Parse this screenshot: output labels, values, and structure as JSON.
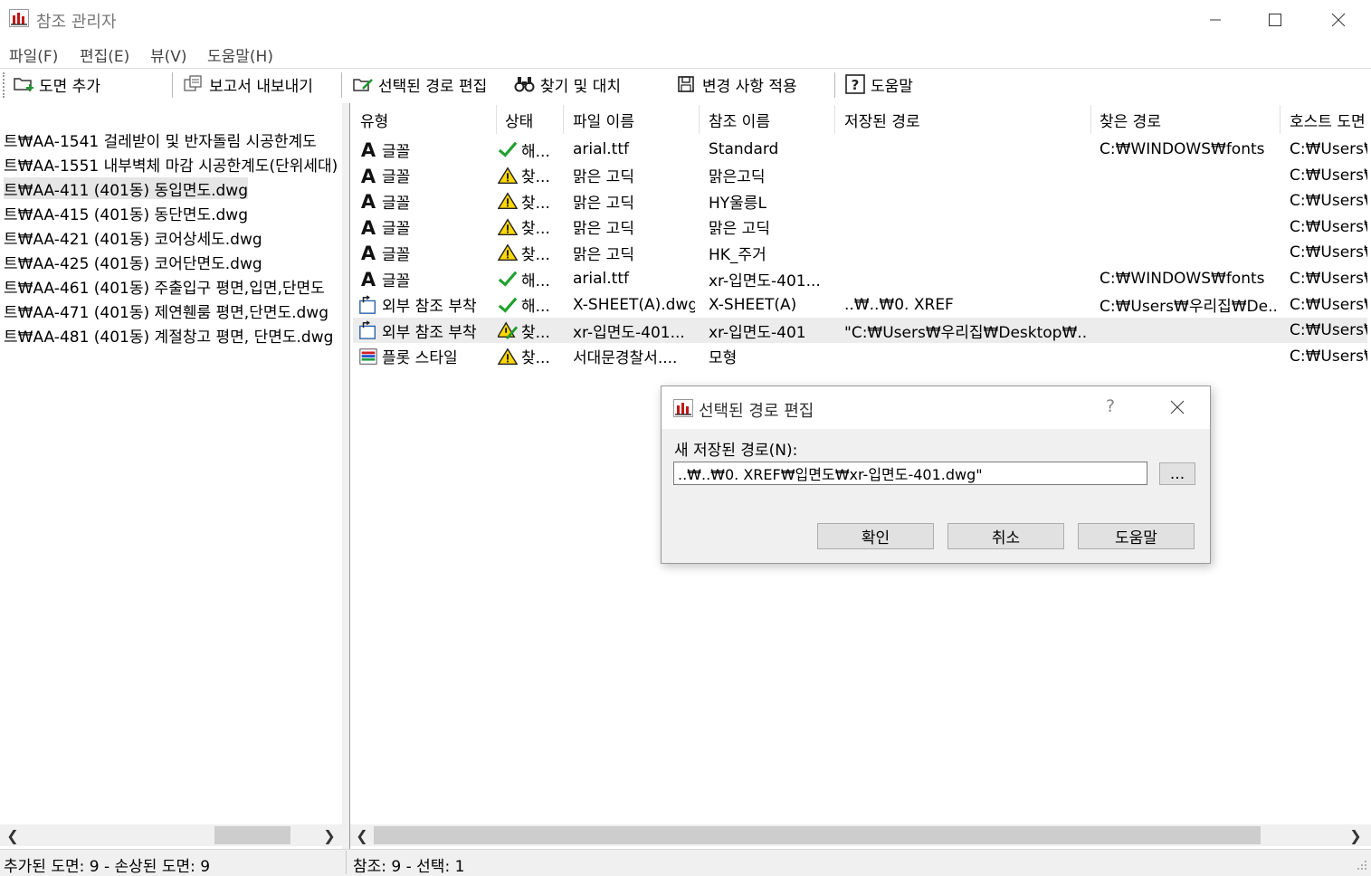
{
  "window": {
    "title": "참조 관리자"
  },
  "menu": [
    "파일(F)",
    "편집(E)",
    "뷰(V)",
    "도움말(H)"
  ],
  "toolbar": {
    "add_drawing": "도면 추가",
    "export_report": "보고서 내보내기",
    "edit_selected_path": "선택된 경로 편집",
    "find_replace": "찾기 및 대치",
    "apply_changes": "변경 사항 적용",
    "help": "도움말"
  },
  "left_pane": {
    "items": [
      "트₩AA-1541 걸레받이 및 반자돌림 시공한계도",
      "트₩AA-1551 내부벽체 마감 시공한계도(단위세대)",
      "트₩AA-411 (401동) 동입면도.dwg",
      "트₩AA-415 (401동) 동단면도.dwg",
      "트₩AA-421 (401동) 코어상세도.dwg",
      "트₩AA-425 (401동) 코어단면도.dwg",
      "트₩AA-461 (401동) 주출입구 평면,입면,단면도",
      "트₩AA-471 (401동) 제연휀룸 평면,단면도.dwg",
      "트₩AA-481 (401동) 계절창고 평면, 단면도.dwg"
    ],
    "selected_index": 2
  },
  "table": {
    "columns": [
      "유형",
      "상태",
      "파일 이름",
      "참조 이름",
      "저장된 경로",
      "찾은 경로",
      "호스트 도면"
    ],
    "rows": [
      {
        "type_icon": "font-icon",
        "type": "글꼴",
        "status_icon": "check-icon",
        "status": "해...",
        "file": "arial.ttf",
        "ref": "Standard",
        "saved": "",
        "found": "C:₩WINDOWS₩fonts",
        "host": "C:₩Users₩"
      },
      {
        "type_icon": "font-icon",
        "type": "글꼴",
        "status_icon": "warning-icon",
        "status": "찾...",
        "file": "맑은 고딕",
        "ref": "맑은고딕",
        "saved": "",
        "found": "",
        "host": "C:₩Users₩"
      },
      {
        "type_icon": "font-icon",
        "type": "글꼴",
        "status_icon": "warning-icon",
        "status": "찾...",
        "file": "맑은 고딕",
        "ref": "HY울릉L",
        "saved": "",
        "found": "",
        "host": "C:₩Users₩"
      },
      {
        "type_icon": "font-icon",
        "type": "글꼴",
        "status_icon": "warning-icon",
        "status": "찾...",
        "file": "맑은 고딕",
        "ref": "맑은 고딕",
        "saved": "",
        "found": "",
        "host": "C:₩Users₩"
      },
      {
        "type_icon": "font-icon",
        "type": "글꼴",
        "status_icon": "warning-icon",
        "status": "찾...",
        "file": "맑은 고딕",
        "ref": "HK_주거",
        "saved": "",
        "found": "",
        "host": "C:₩Users₩"
      },
      {
        "type_icon": "font-icon",
        "type": "글꼴",
        "status_icon": "check-icon",
        "status": "해...",
        "file": "arial.ttf",
        "ref": "xr-입면도-401...",
        "saved": "",
        "found": "C:₩WINDOWS₩fonts",
        "host": "C:₩Users₩"
      },
      {
        "type_icon": "xref-icon",
        "type": "외부 참조 부착",
        "status_icon": "check-icon",
        "status": "해...",
        "file": "X-SHEET(A).dwg",
        "ref": "X-SHEET(A)",
        "saved": "..₩..₩0. XREF",
        "found": "C:₩Users₩우리집₩De...",
        "host": "C:₩Users₩"
      },
      {
        "type_icon": "xref-icon",
        "type": "외부 참조 부착",
        "status_icon": "edit-warning-icon",
        "status": "찾...",
        "file": "xr-입면도-401...",
        "ref": "xr-입면도-401",
        "saved": "\"C:₩Users₩우리집₩Desktop₩...",
        "found": "",
        "host": "C:₩Users₩"
      },
      {
        "type_icon": "plotstyle-icon",
        "type": "플롯 스타일",
        "status_icon": "warning-icon",
        "status": "찾...",
        "file": "서대문경찰서....",
        "ref": "모형",
        "saved": "",
        "found": "",
        "host": "C:₩Users₩"
      }
    ],
    "selected_row": 7
  },
  "status_bar": {
    "left": "추가된 도면: 9  -  손상된 도면: 9",
    "right": "참조: 9  -  선택: 1"
  },
  "dialog": {
    "title": "선택된 경로 편집",
    "help_glyph": "?",
    "label": "새 저장된 경로(N):",
    "value": "..₩..₩0. XREF₩입면도₩xr-입면도-401.dwg\"",
    "browse": "...",
    "ok": "확인",
    "cancel": "취소",
    "help": "도움말"
  },
  "colors": {
    "check": "#22a030",
    "warning_fill": "#ffd800",
    "selection": "#ececec"
  }
}
